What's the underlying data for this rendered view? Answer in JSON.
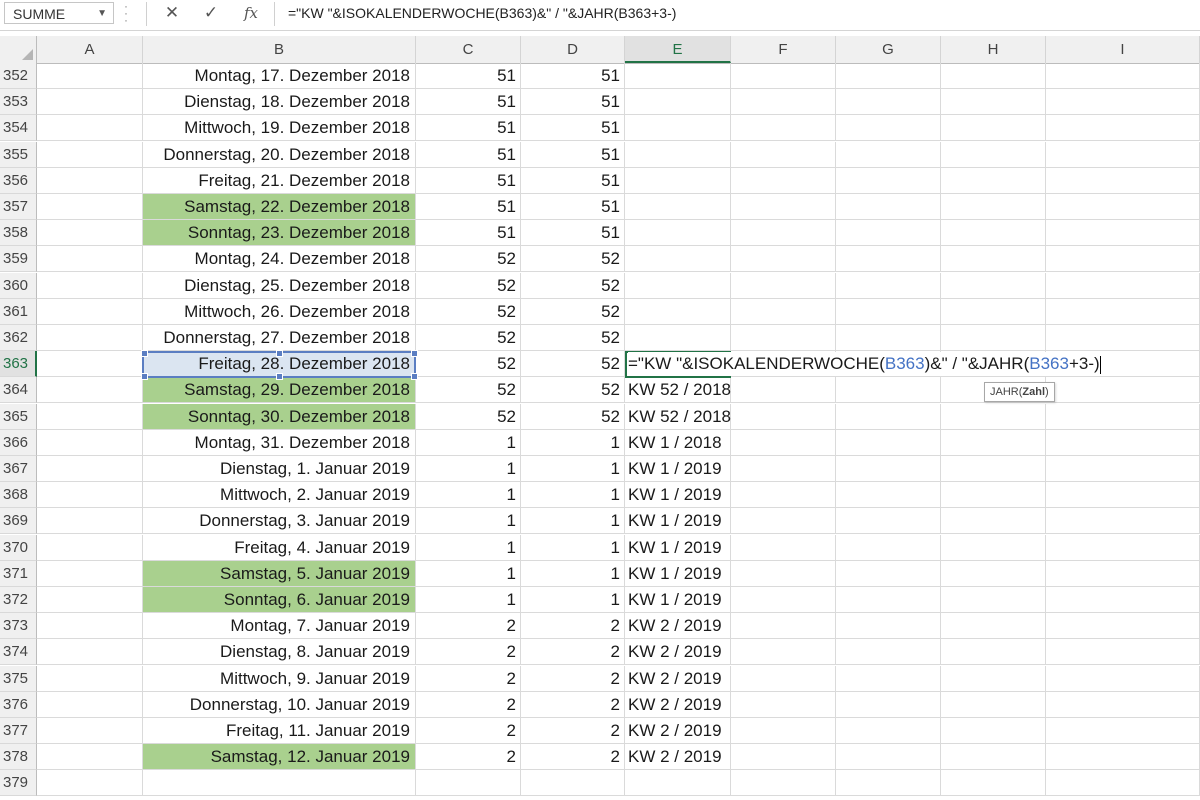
{
  "formula_bar": {
    "name_box": "SUMME",
    "formula": "=\"KW \"&ISOKALENDERWOCHE(B363)&\" / \"&JAHR(B363+3-)",
    "cancel_icon": "✕",
    "enter_icon": "✓",
    "fx_label": "fx"
  },
  "columns": [
    "A",
    "B",
    "C",
    "D",
    "E",
    "F",
    "G",
    "H",
    "I"
  ],
  "rows": [
    {
      "n": "352",
      "b": "Montag, 17. Dezember 2018",
      "c": "51",
      "d": "51",
      "e": "",
      "weekend": false
    },
    {
      "n": "353",
      "b": "Dienstag, 18. Dezember 2018",
      "c": "51",
      "d": "51",
      "e": "",
      "weekend": false
    },
    {
      "n": "354",
      "b": "Mittwoch, 19. Dezember 2018",
      "c": "51",
      "d": "51",
      "e": "",
      "weekend": false
    },
    {
      "n": "355",
      "b": "Donnerstag, 20. Dezember 2018",
      "c": "51",
      "d": "51",
      "e": "",
      "weekend": false
    },
    {
      "n": "356",
      "b": "Freitag, 21. Dezember 2018",
      "c": "51",
      "d": "51",
      "e": "",
      "weekend": false
    },
    {
      "n": "357",
      "b": "Samstag, 22. Dezember 2018",
      "c": "51",
      "d": "51",
      "e": "",
      "weekend": true
    },
    {
      "n": "358",
      "b": "Sonntag, 23. Dezember 2018",
      "c": "51",
      "d": "51",
      "e": "",
      "weekend": true
    },
    {
      "n": "359",
      "b": "Montag, 24. Dezember 2018",
      "c": "52",
      "d": "52",
      "e": "",
      "weekend": false
    },
    {
      "n": "360",
      "b": "Dienstag, 25. Dezember 2018",
      "c": "52",
      "d": "52",
      "e": "",
      "weekend": false
    },
    {
      "n": "361",
      "b": "Mittwoch, 26. Dezember 2018",
      "c": "52",
      "d": "52",
      "e": "",
      "weekend": false
    },
    {
      "n": "362",
      "b": "Donnerstag, 27. Dezember 2018",
      "c": "52",
      "d": "52",
      "e": "",
      "weekend": false
    },
    {
      "n": "363",
      "b": "Freitag, 28. Dezember 2018",
      "c": "52",
      "d": "52",
      "e": "",
      "weekend": false,
      "selected": true
    },
    {
      "n": "364",
      "b": "Samstag, 29. Dezember 2018",
      "c": "52",
      "d": "52",
      "e": "KW 52 / 2018",
      "weekend": true
    },
    {
      "n": "365",
      "b": "Sonntag, 30. Dezember 2018",
      "c": "52",
      "d": "52",
      "e": "KW 52 / 2018",
      "weekend": true
    },
    {
      "n": "366",
      "b": "Montag, 31. Dezember 2018",
      "c": "1",
      "d": "1",
      "e": "KW 1 / 2018",
      "weekend": false
    },
    {
      "n": "367",
      "b": "Dienstag, 1. Januar 2019",
      "c": "1",
      "d": "1",
      "e": "KW 1 / 2019",
      "weekend": false
    },
    {
      "n": "368",
      "b": "Mittwoch, 2. Januar 2019",
      "c": "1",
      "d": "1",
      "e": "KW 1 / 2019",
      "weekend": false
    },
    {
      "n": "369",
      "b": "Donnerstag, 3. Januar 2019",
      "c": "1",
      "d": "1",
      "e": "KW 1 / 2019",
      "weekend": false
    },
    {
      "n": "370",
      "b": "Freitag, 4. Januar 2019",
      "c": "1",
      "d": "1",
      "e": "KW 1 / 2019",
      "weekend": false
    },
    {
      "n": "371",
      "b": "Samstag, 5. Januar 2019",
      "c": "1",
      "d": "1",
      "e": "KW 1 / 2019",
      "weekend": true
    },
    {
      "n": "372",
      "b": "Sonntag, 6. Januar 2019",
      "c": "1",
      "d": "1",
      "e": "KW 1 / 2019",
      "weekend": true
    },
    {
      "n": "373",
      "b": "Montag, 7. Januar 2019",
      "c": "2",
      "d": "2",
      "e": "KW 2 / 2019",
      "weekend": false
    },
    {
      "n": "374",
      "b": "Dienstag, 8. Januar 2019",
      "c": "2",
      "d": "2",
      "e": "KW 2 / 2019",
      "weekend": false
    },
    {
      "n": "375",
      "b": "Mittwoch, 9. Januar 2019",
      "c": "2",
      "d": "2",
      "e": "KW 2 / 2019",
      "weekend": false
    },
    {
      "n": "376",
      "b": "Donnerstag, 10. Januar 2019",
      "c": "2",
      "d": "2",
      "e": "KW 2 / 2019",
      "weekend": false
    },
    {
      "n": "377",
      "b": "Freitag, 11. Januar 2019",
      "c": "2",
      "d": "2",
      "e": "KW 2 / 2019",
      "weekend": false
    },
    {
      "n": "378",
      "b": "Samstag, 12. Januar 2019",
      "c": "2",
      "d": "2",
      "e": "KW 2 / 2019",
      "weekend": true
    },
    {
      "n": "379",
      "b": "",
      "c": "",
      "d": "",
      "e": "",
      "weekend": false
    }
  ],
  "edit_cell": {
    "part1": "=\"KW \"&ISOKALENDERWOCHE(",
    "ref1": "B363",
    "part2": ")&\" / \"&JAHR(",
    "ref2": "B363",
    "part3": "+3-)"
  },
  "tooltip": {
    "func": "JAHR(",
    "arg": "Zahl",
    "close": ")"
  },
  "colors": {
    "weekend_fill": "#a9d08e",
    "selection_border": "#5b7ec2",
    "edit_border": "#217346",
    "reference_blue": "#4472c4"
  }
}
